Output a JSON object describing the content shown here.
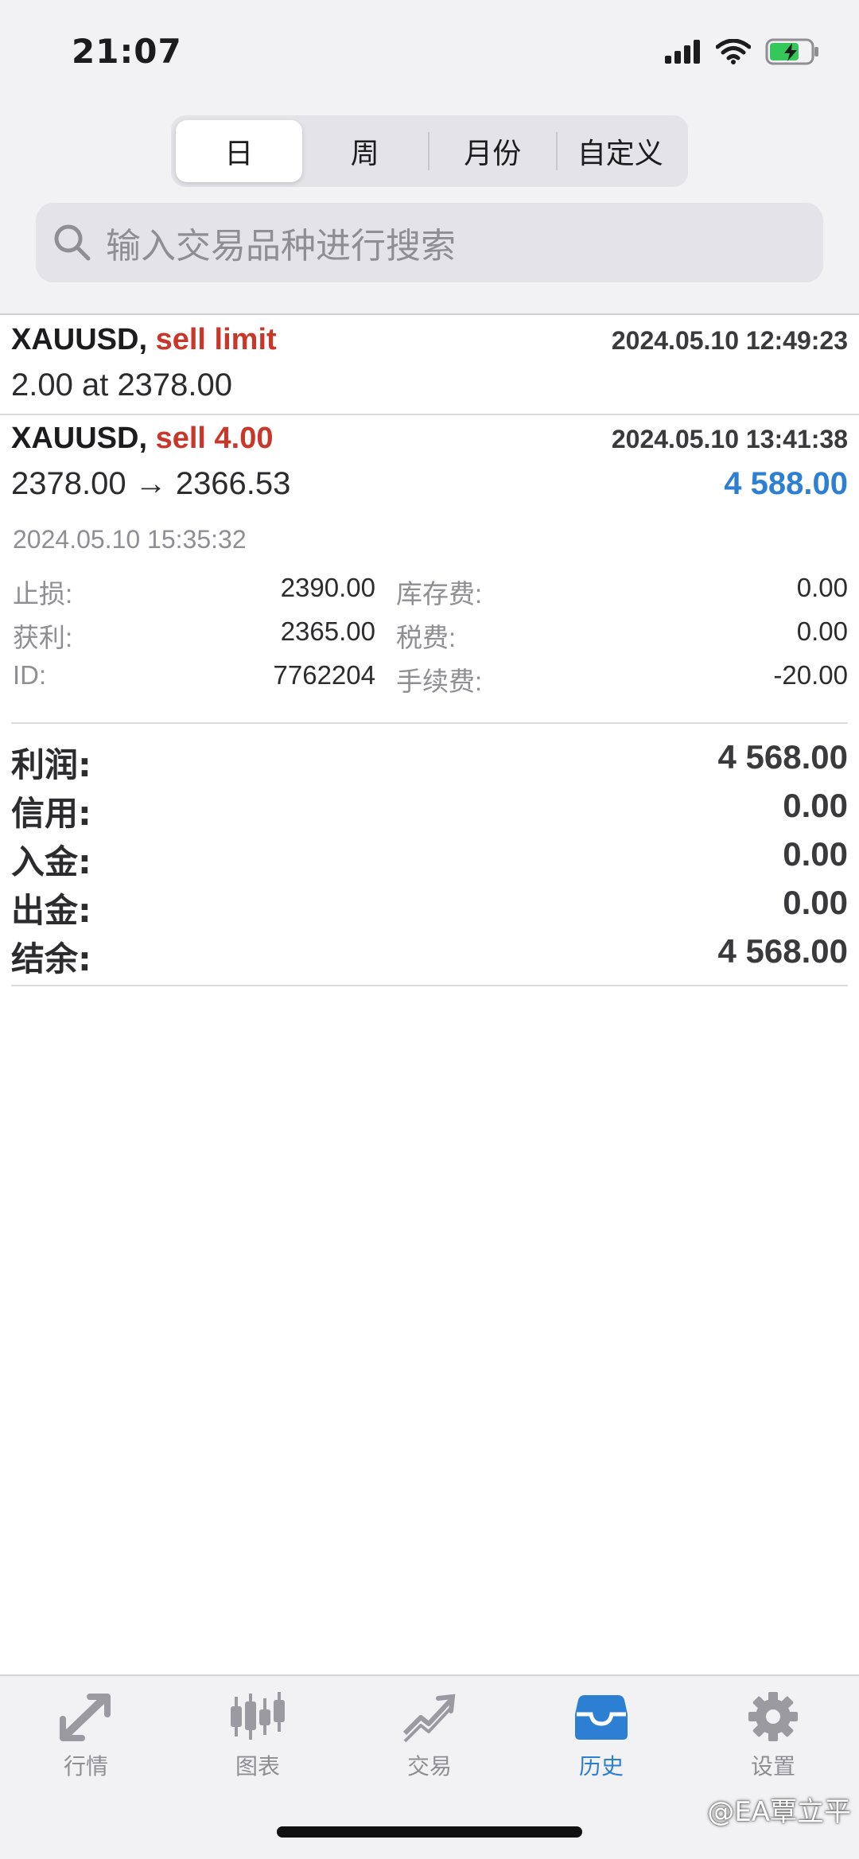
{
  "status": {
    "time": "21:07"
  },
  "period_tabs": [
    {
      "label": "日",
      "active": true
    },
    {
      "label": "周",
      "active": false
    },
    {
      "label": "月份",
      "active": false
    },
    {
      "label": "自定义",
      "active": false
    }
  ],
  "search": {
    "placeholder": "输入交易品种进行搜索"
  },
  "orders": [
    {
      "symbol": "XAUUSD,",
      "type": "sell limit",
      "time": "2024.05.10 12:49:23",
      "line2": "2.00 at 2378.00"
    },
    {
      "symbol": "XAUUSD,",
      "type": "sell 4.00",
      "time": "2024.05.10 13:41:38",
      "line2": "2378.00 → 2366.53",
      "profit": "4 588.00",
      "close_time": "2024.05.10 15:35:32",
      "details": {
        "sl_label": "止损:",
        "sl_value": "2390.00",
        "swap_label": "库存费:",
        "swap_value": "0.00",
        "tp_label": "获利:",
        "tp_value": "2365.00",
        "tax_label": "税费:",
        "tax_value": "0.00",
        "id_label": "ID:",
        "id_value": "7762204",
        "fee_label": "手续费:",
        "fee_value": "-20.00"
      }
    }
  ],
  "summary": [
    {
      "label": "利润:",
      "value": "4 568.00"
    },
    {
      "label": "信用:",
      "value": "0.00"
    },
    {
      "label": "入金:",
      "value": "0.00"
    },
    {
      "label": "出金:",
      "value": "0.00"
    },
    {
      "label": "结余:",
      "value": "4 568.00"
    }
  ],
  "tabbar": [
    {
      "label": "行情",
      "icon": "quotes-icon",
      "active": false
    },
    {
      "label": "图表",
      "icon": "chart-icon",
      "active": false
    },
    {
      "label": "交易",
      "icon": "trade-icon",
      "active": false
    },
    {
      "label": "历史",
      "icon": "history-icon",
      "active": true
    },
    {
      "label": "设置",
      "icon": "settings-icon",
      "active": false
    }
  ],
  "watermark": "@EA覃立平",
  "colors": {
    "accent": "#2d7fd3",
    "sell": "#c8372a",
    "battery": "#34c759"
  }
}
